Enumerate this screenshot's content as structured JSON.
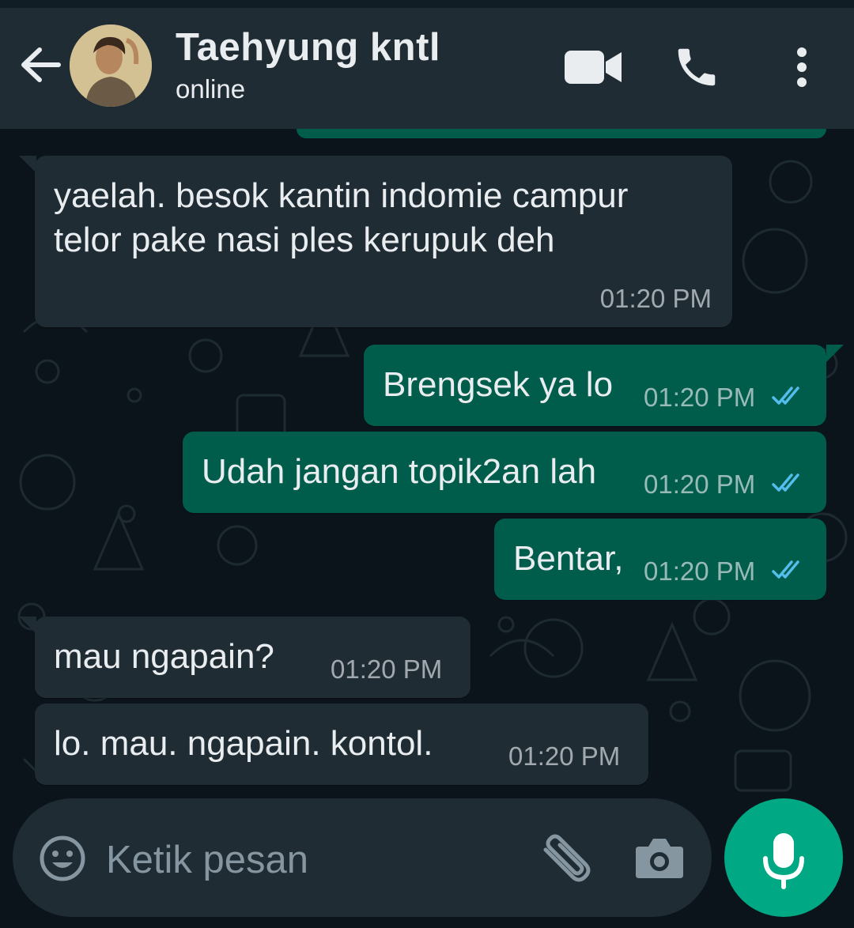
{
  "header": {
    "contact_name": "Taehyung kntl",
    "contact_status": "online",
    "icons": [
      "back-arrow-icon",
      "avatar",
      "video-call-icon",
      "phone-icon",
      "more-vert-icon"
    ]
  },
  "messages": [
    {
      "direction": "in",
      "lines": [
        "yaelah. besok kantin indomie campur",
        "telor pake nasi ples kerupuk deh"
      ],
      "time": "01:20 PM"
    },
    {
      "direction": "out",
      "text": "Brengsek ya lo",
      "time": "01:20 PM",
      "status": "read"
    },
    {
      "direction": "out",
      "text": "Udah jangan topik2an lah",
      "time": "01:20 PM",
      "status": "read"
    },
    {
      "direction": "out",
      "text": "Bentar,",
      "time": "01:20 PM",
      "status": "read"
    },
    {
      "direction": "in",
      "text": "mau ngapain?",
      "time": "01:20 PM"
    },
    {
      "direction": "in",
      "text": "lo. mau. ngapain. kontol.",
      "time": "01:20 PM"
    }
  ],
  "composer": {
    "placeholder": "Ketik pesan",
    "icons": [
      "emoji-icon",
      "attach-icon",
      "camera-icon",
      "mic-icon"
    ]
  },
  "colors": {
    "background": "#0b141a",
    "header": "#1f2c34",
    "incoming_bubble": "#1f2c34",
    "outgoing_bubble": "#005c4b",
    "read_tick": "#53bdeb",
    "mic_button": "#00a884"
  }
}
